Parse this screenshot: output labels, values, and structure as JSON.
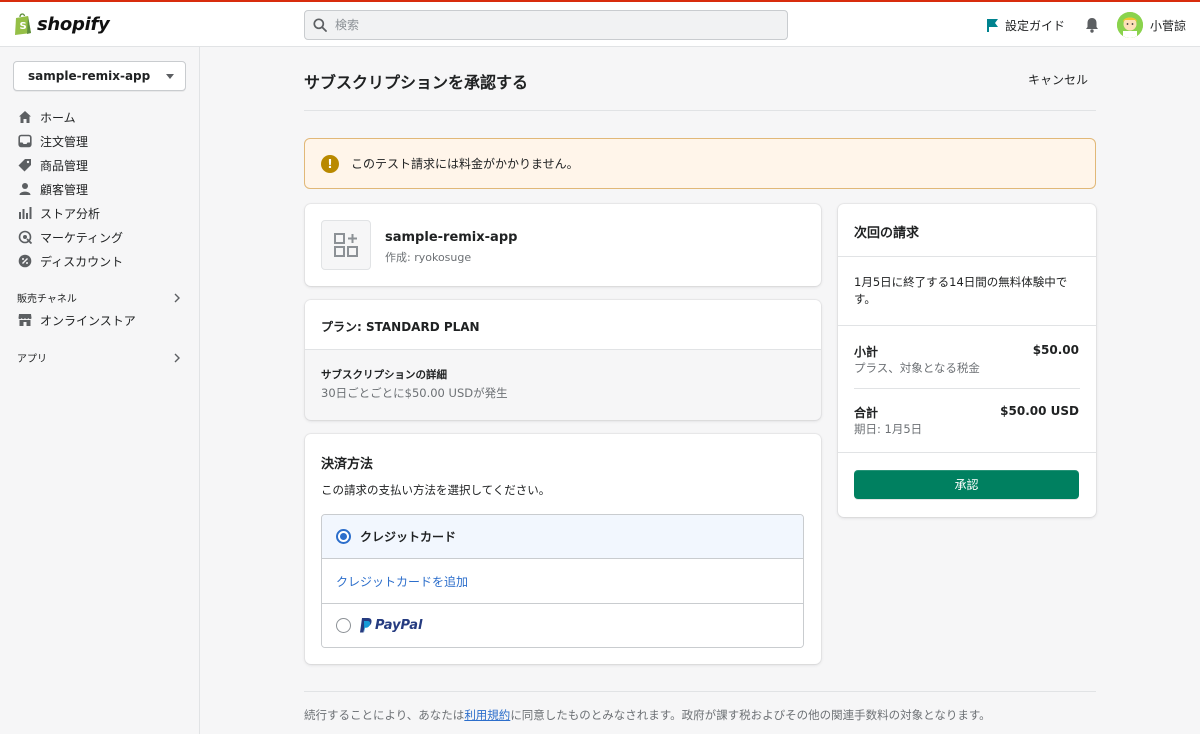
{
  "topbar": {
    "logo_text": "shopify",
    "search_placeholder": "検索",
    "setup_guide": "設定ガイド",
    "user_name": "小菅諒"
  },
  "sidebar": {
    "store_name": "sample-remix-app",
    "items": [
      {
        "label": "ホーム",
        "icon": "home-icon"
      },
      {
        "label": "注文管理",
        "icon": "inbox-icon"
      },
      {
        "label": "商品管理",
        "icon": "tag-icon"
      },
      {
        "label": "顧客管理",
        "icon": "person-icon"
      },
      {
        "label": "ストア分析",
        "icon": "bar-chart-icon"
      },
      {
        "label": "マーケティング",
        "icon": "target-icon"
      },
      {
        "label": "ディスカウント",
        "icon": "discount-icon"
      }
    ],
    "sales_channels": "販売チャネル",
    "online_store": "オンラインストア",
    "apps": "アプリ"
  },
  "main": {
    "title": "サブスクリプションを承認する",
    "cancel": "キャンセル",
    "banner": "このテスト請求には料金がかかりません。",
    "app": {
      "name": "sample-remix-app",
      "author": "作成: ryokosuge"
    },
    "plan": {
      "name": "プラン: STANDARD PLAN",
      "details_heading": "サブスクリプションの詳細",
      "details": "30日ごとごとに$50.00 USDが発生"
    },
    "payment": {
      "title": "決済方法",
      "description": "この請求の支払い方法を選択してください。",
      "credit_card": "クレジットカード",
      "add_card": "クレジットカードを追加",
      "paypal": "PayPal",
      "selected": "credit_card"
    },
    "summary": {
      "title": "次回の請求",
      "trial": "1月5日に終了する14日間の無料体験中です。",
      "subtotal_label": "小計",
      "subtotal_value": "$50.00",
      "subtotal_sub": "プラス、対象となる税金",
      "total_label": "合計",
      "total_value": "$50.00 USD",
      "total_sub": "期日: 1月5日",
      "approve": "承認"
    },
    "footer": {
      "before": "続行することにより、あなたは",
      "link": "利用規約",
      "after": "に同意したものとみなされます。政府が課す税およびその他の関連手数料の対象となります。"
    }
  },
  "colors": {
    "primary": "#008060",
    "link": "#2c6ecb",
    "warning": "#b98900",
    "banner_bg": "#fff5ea",
    "topbar_accent": "#d82c0d"
  }
}
